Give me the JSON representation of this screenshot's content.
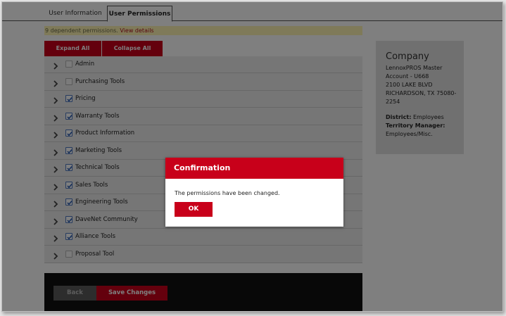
{
  "tabs": [
    {
      "label": "User Information",
      "active": false
    },
    {
      "label": "User Permissions",
      "active": true
    }
  ],
  "dependent_bar": {
    "text": "9 dependent permissions. ",
    "link": "View details"
  },
  "toolbar": {
    "expand_label": "Expand All",
    "collapse_label": "Collapse All"
  },
  "permissions": [
    {
      "label": "Admin",
      "checked": false
    },
    {
      "label": "Purchasing Tools",
      "checked": false
    },
    {
      "label": "Pricing",
      "checked": true
    },
    {
      "label": "Warranty Tools",
      "checked": true
    },
    {
      "label": "Product Information",
      "checked": true
    },
    {
      "label": "Marketing Tools",
      "checked": true
    },
    {
      "label": "Technical Tools",
      "checked": true
    },
    {
      "label": "Sales Tools",
      "checked": true
    },
    {
      "label": "Engineering Tools",
      "checked": true
    },
    {
      "label": "DaveNet Community",
      "checked": true
    },
    {
      "label": "Alliance Tools",
      "checked": true
    },
    {
      "label": "Proposal Tool",
      "checked": false
    }
  ],
  "company": {
    "heading": "Company",
    "address": [
      "LennoxPROS Master",
      "Account - U668",
      "2100 LAKE BLVD",
      "RICHARDSON, TX 75080-",
      "2254"
    ],
    "district_label": "District:",
    "district_value": "Employees",
    "tm_label": "Territory Manager:",
    "tm_value": "Employees/Misc."
  },
  "footer": {
    "back_label": "Back",
    "save_label": "Save Changes"
  },
  "dialog": {
    "title": "Confirmation",
    "message": "The permissions have been changed.",
    "ok_label": "OK"
  },
  "colors": {
    "brand_red": "#c8001a",
    "checkbox_blue": "#4c77c0",
    "notice_yellow": "#fff5b2"
  }
}
